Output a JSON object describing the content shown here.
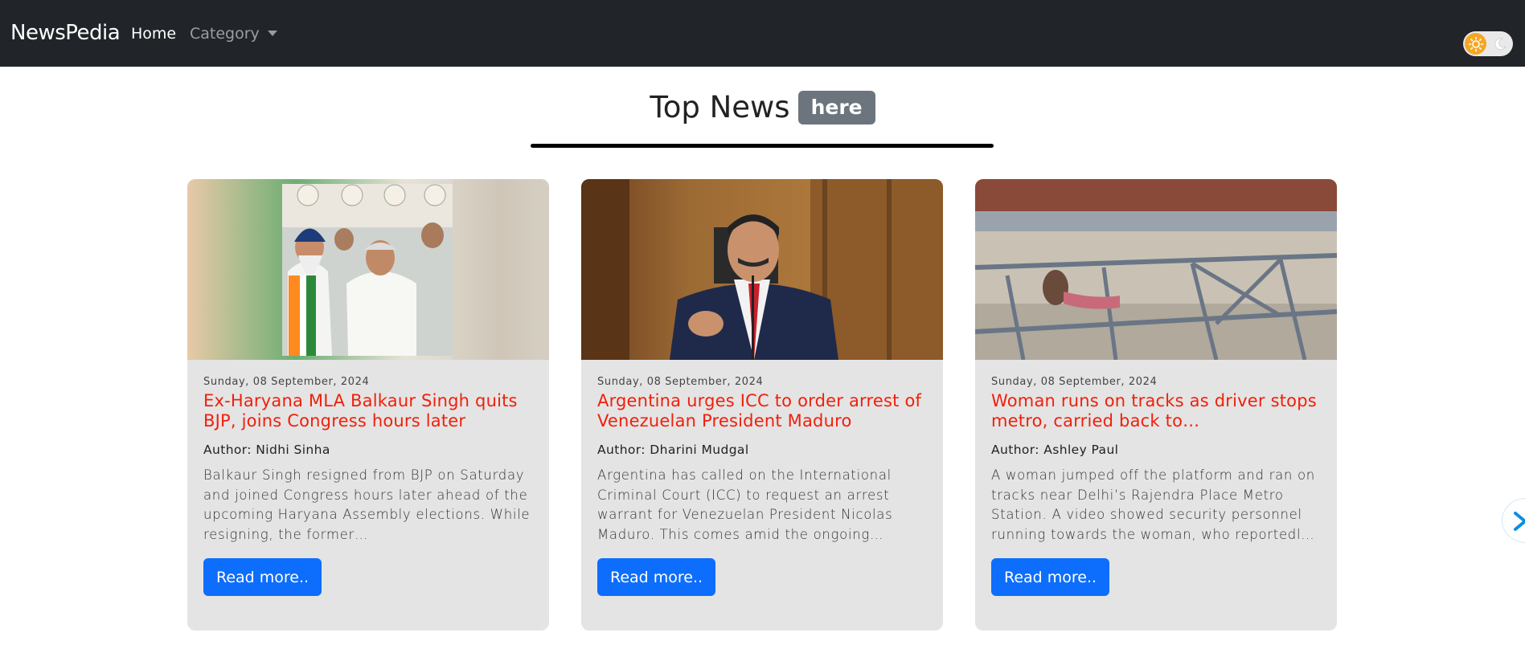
{
  "navbar": {
    "brand": "NewsPedia",
    "links": {
      "home": "Home",
      "category": "Category"
    }
  },
  "heading": {
    "title": "Top News",
    "badge": "here"
  },
  "cards": [
    {
      "date": "Sunday, 08 September, 2024",
      "title": "Ex-Haryana MLA Balkaur Singh quits BJP, joins Congress hours later",
      "author": "Author: Nidhi Sinha",
      "description": "Balkaur Singh resigned from BJP on Saturday and joined Congress hours later ahead of the upcoming Haryana Assembly elections. While resigning, the former…",
      "button": "Read more.."
    },
    {
      "date": "Sunday, 08 September, 2024",
      "title": "Argentina urges ICC to order arrest of Venezuelan President Maduro",
      "author": "Author: Dharini Mudgal",
      "description": "Argentina has called on the International Criminal Court (ICC) to request an arrest warrant for Venezuelan President Nicolas Maduro. This comes amid the ongoing…",
      "button": "Read more.."
    },
    {
      "date": "Sunday, 08 September, 2024",
      "title": "Woman runs on tracks as driver stops metro, carried back to…",
      "author": "Author: Ashley Paul",
      "description": "A woman jumped off the platform and ran on tracks near Delhi’s Rajendra Place Metro Station. A video showed security personnel running towards the woman, who reportedl…",
      "button": "Read more.."
    }
  ],
  "colors": {
    "navbar": "#212529",
    "title": "#f0200b",
    "button": "#0d6efd",
    "badge": "#6c757d",
    "card": "#e4e4e4"
  },
  "icons": [
    "sun-icon",
    "moon-icon",
    "chevron-right-icon"
  ]
}
